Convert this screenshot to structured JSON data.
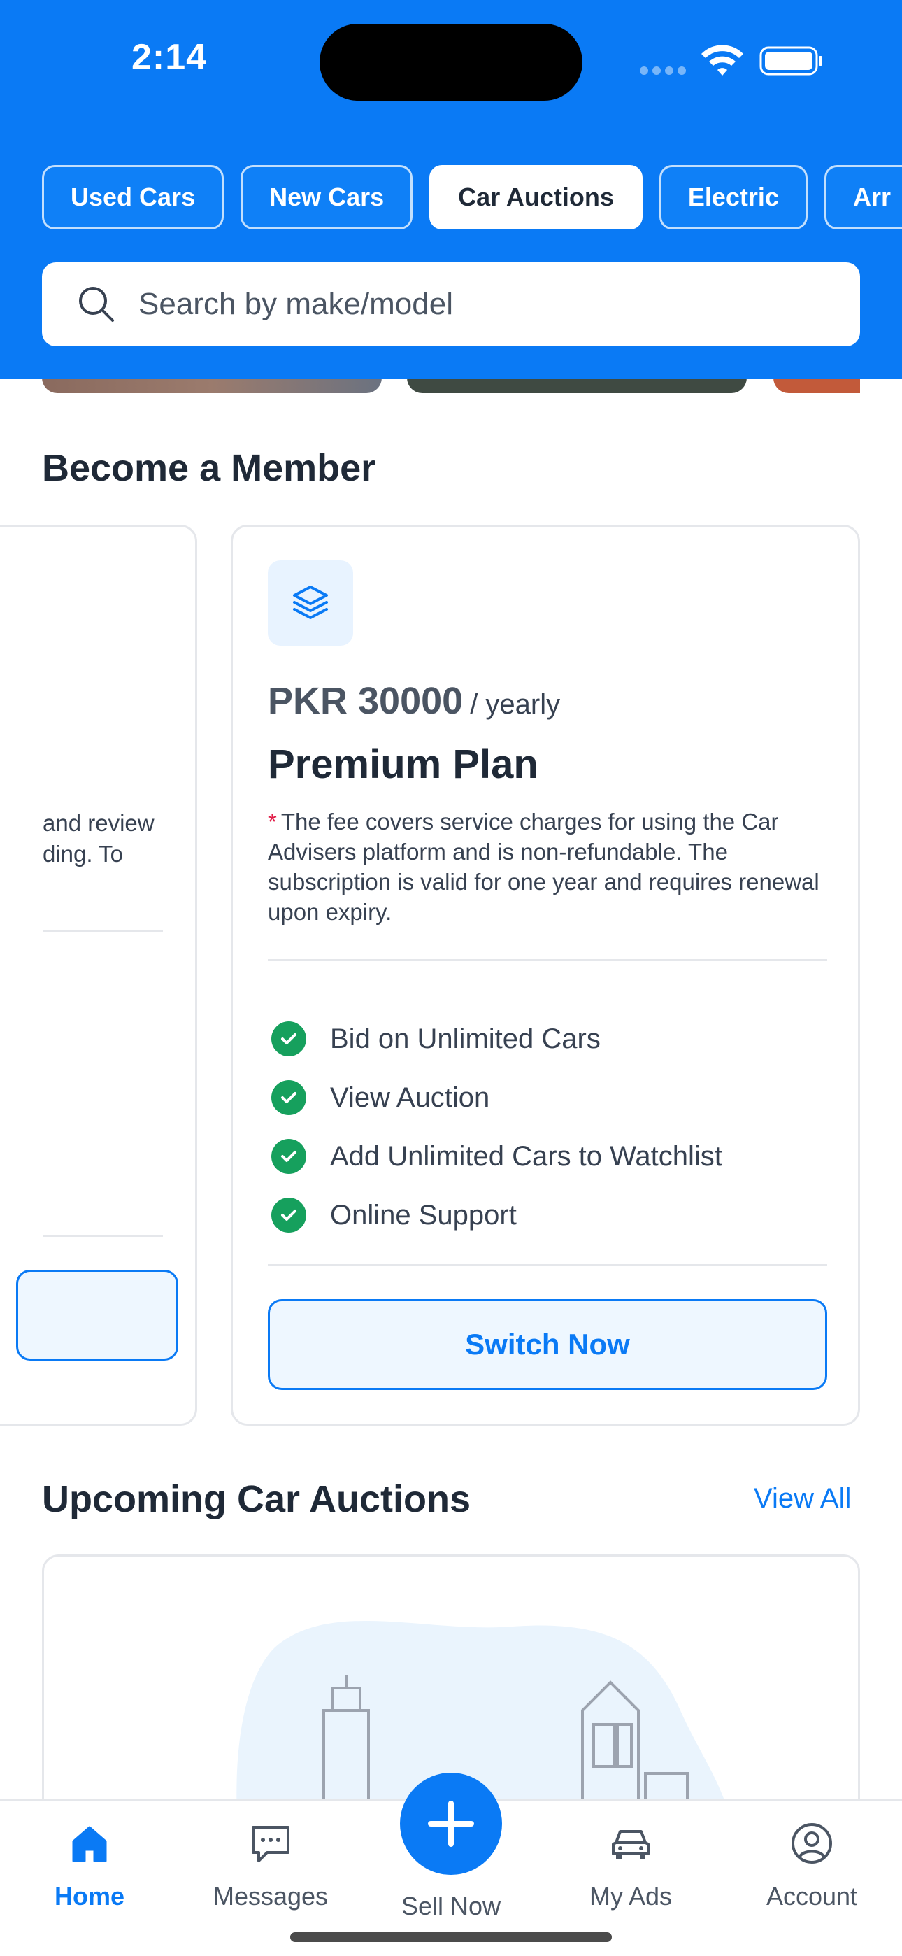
{
  "status_bar": {
    "time": "2:14"
  },
  "tabs": [
    {
      "label": "Used Cars",
      "active": false
    },
    {
      "label": "New Cars",
      "active": false
    },
    {
      "label": "Car Auctions",
      "active": true
    },
    {
      "label": "Electric",
      "active": false
    },
    {
      "label": "Arr",
      "active": false
    }
  ],
  "search": {
    "placeholder": "Search by make/model",
    "icon": "search-icon"
  },
  "membership": {
    "title": "Become a Member",
    "previous_card": {
      "description_fragment": "and review\nding. To"
    },
    "plan": {
      "icon": "layers-icon",
      "price": "PKR 30000",
      "period": "/ yearly",
      "name": "Premium Plan",
      "note_marker": "*",
      "description": "The fee covers service charges for using the Car Advisers platform and is non-refundable. The subscription is valid for one year and requires renewal upon expiry.",
      "features": [
        "Bid on Unlimited Cars",
        "View Auction",
        "Add Unlimited Cars to Watchlist",
        "Online Support"
      ],
      "button_label": "Switch Now"
    }
  },
  "upcoming": {
    "title": "Upcoming Car Auctions",
    "view_all_label": "View All"
  },
  "bottom_nav": {
    "items": [
      {
        "label": "Home",
        "icon": "home-icon",
        "active": true
      },
      {
        "label": "Messages",
        "icon": "messages-icon",
        "active": false
      },
      {
        "label": "Sell Now",
        "icon": "plus-icon",
        "active": false
      },
      {
        "label": "My Ads",
        "icon": "car-icon",
        "active": false
      },
      {
        "label": "Account",
        "icon": "account-icon",
        "active": false
      }
    ]
  },
  "colors": {
    "primary": "#0a7af5",
    "success": "#16a05d",
    "required": "#e11d48",
    "text": "#1f2937"
  }
}
